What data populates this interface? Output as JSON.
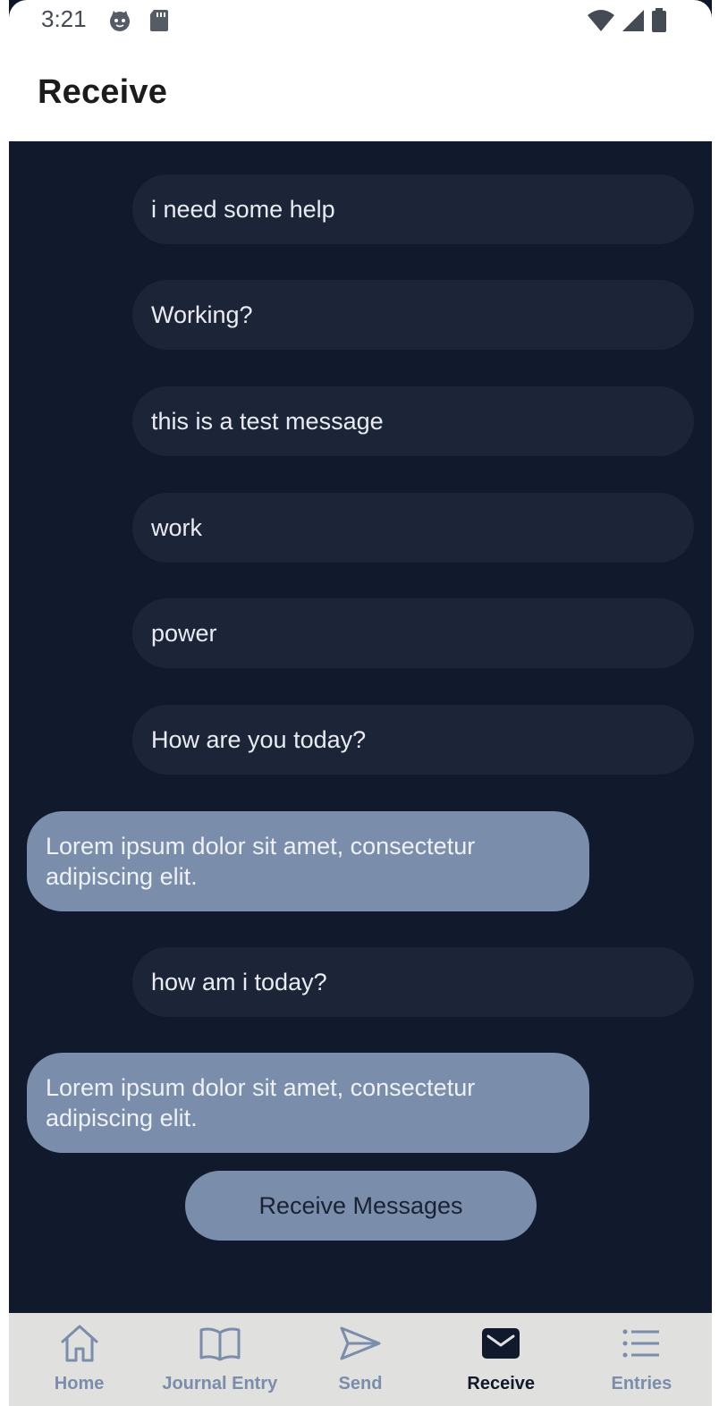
{
  "status_bar": {
    "time": "3:21"
  },
  "app_bar": {
    "title": "Receive"
  },
  "messages": [
    {
      "type": "sent",
      "text": "i need some help"
    },
    {
      "type": "sent",
      "text": "Working?"
    },
    {
      "type": "sent",
      "text": "this is a test message"
    },
    {
      "type": "sent",
      "text": "work"
    },
    {
      "type": "sent",
      "text": "power"
    },
    {
      "type": "sent",
      "text": "How are you today?"
    },
    {
      "type": "received",
      "text": "Lorem ipsum dolor sit amet, consectetur adipiscing elit."
    },
    {
      "type": "sent",
      "text": "how am i today?"
    },
    {
      "type": "received",
      "text": "Lorem ipsum dolor sit amet, consectetur adipiscing elit."
    }
  ],
  "receive_button": {
    "label": "Receive Messages"
  },
  "bottom_nav": {
    "items": [
      {
        "label": "Home",
        "icon": "home-icon"
      },
      {
        "label": "Journal Entry",
        "icon": "book-icon"
      },
      {
        "label": "Send",
        "icon": "send-icon"
      },
      {
        "label": "Receive",
        "icon": "mail-icon",
        "active": true
      },
      {
        "label": "Entries",
        "icon": "list-icon"
      }
    ]
  },
  "colors": {
    "background": "#101a2c",
    "sent_bubble": "#1c2538",
    "received_bubble": "#7a8dab",
    "accent": "#7a8dab",
    "nav_background": "#e0e0df",
    "active_nav": "#101a2c"
  }
}
